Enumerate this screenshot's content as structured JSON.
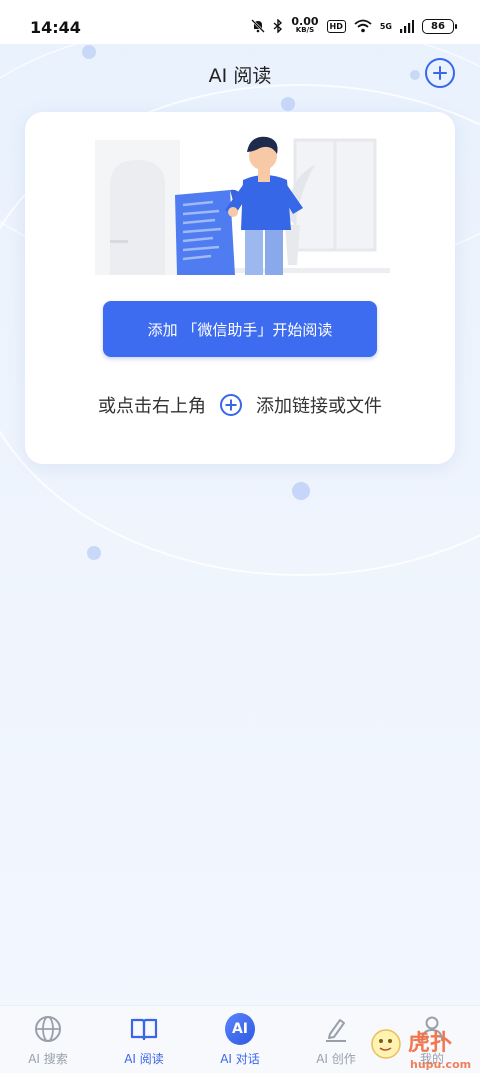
{
  "status_bar": {
    "time": "14:44",
    "speed_value": "0.00",
    "speed_unit": "KB/S",
    "hd": "HD",
    "network": "5G",
    "battery": "86"
  },
  "header": {
    "title": "AI 阅读"
  },
  "card": {
    "cta_label": "添加 「微信助手」开始阅读",
    "hint_prefix": "或点击右上角",
    "hint_suffix": "添加链接或文件"
  },
  "tabs": [
    {
      "label": "AI 搜索",
      "icon": "globe-icon"
    },
    {
      "label": "AI 阅读",
      "icon": "book-icon"
    },
    {
      "label": "AI 对话",
      "icon": "ai-chat-icon",
      "badge": "AI"
    },
    {
      "label": "AI 创作",
      "icon": "pencil-icon"
    },
    {
      "label": "我的",
      "icon": "person-icon"
    }
  ],
  "colors": {
    "accent": "#3e6cf0",
    "background": "#eef4fd"
  }
}
